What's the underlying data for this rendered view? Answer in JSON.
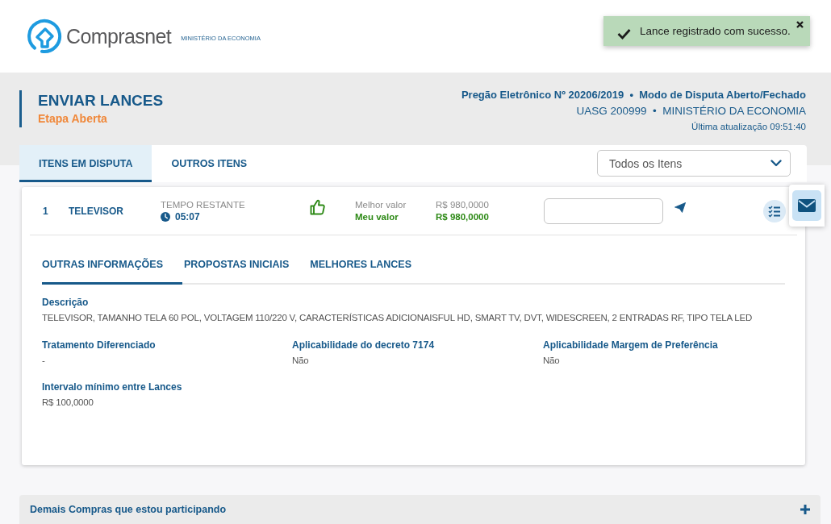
{
  "header": {
    "logo_text": "Comprasnet",
    "ministry": "MINISTÉRIO DA ECONOMIA"
  },
  "toast": {
    "message": "Lance registrado com sucesso."
  },
  "page_header": {
    "title": "ENVIAR LANCES",
    "stage": "Etapa Aberta",
    "process_line": "Pregão Eletrônico Nº 20206/2019  •  Modo de Disputa Aberto/Fechado",
    "organ_line": "UASG 200999  •  MINISTÉRIO DA ECONOMIA",
    "last_update": "Última atualização 09:51:40"
  },
  "tabs": [
    {
      "label": "ITENS EM DISPUTA",
      "selected": true
    },
    {
      "label": "OUTROS ITENS",
      "selected": false
    }
  ],
  "filter": {
    "value": "Todos os Itens"
  },
  "items": [
    {
      "number": "1",
      "name": "TELEVISOR",
      "time_label": "TEMPO RESTANTE",
      "time_remaining": "05:07",
      "winning": true,
      "best_label": "Melhor valor",
      "my_label": "Meu valor",
      "best_value": "R$ 980,0000",
      "my_value": "R$ 980,0000",
      "detail_tabs": [
        {
          "label": "OUTRAS INFORMAÇÕES",
          "selected": true
        },
        {
          "label": "PROPOSTAS INICIAIS",
          "selected": false
        },
        {
          "label": "MELHORES LANCES",
          "selected": false
        }
      ],
      "description": {
        "label": "Descrição",
        "value": "TELEVISOR, TAMANHO TELA 60 POL, VOLTAGEM 110/220 V, CARACTERÍSTICAS ADICIONAISFUL HD, SMART TV, DVT, WIDESCREEN, 2 ENTRADAS RF, TIPO TELA LED"
      },
      "fields": [
        {
          "label": "Tratamento Diferenciado",
          "value": "-"
        },
        {
          "label": "Aplicabilidade do decreto 7174",
          "value": "Não"
        },
        {
          "label": "Aplicabilidade Margem de Preferência",
          "value": "Não"
        },
        {
          "label": "Intervalo mínimo entre Lances",
          "value": "R$ 100,0000"
        }
      ]
    }
  ],
  "other_purchases": {
    "label": "Demais Compras que estou participando",
    "expanded": false
  }
}
